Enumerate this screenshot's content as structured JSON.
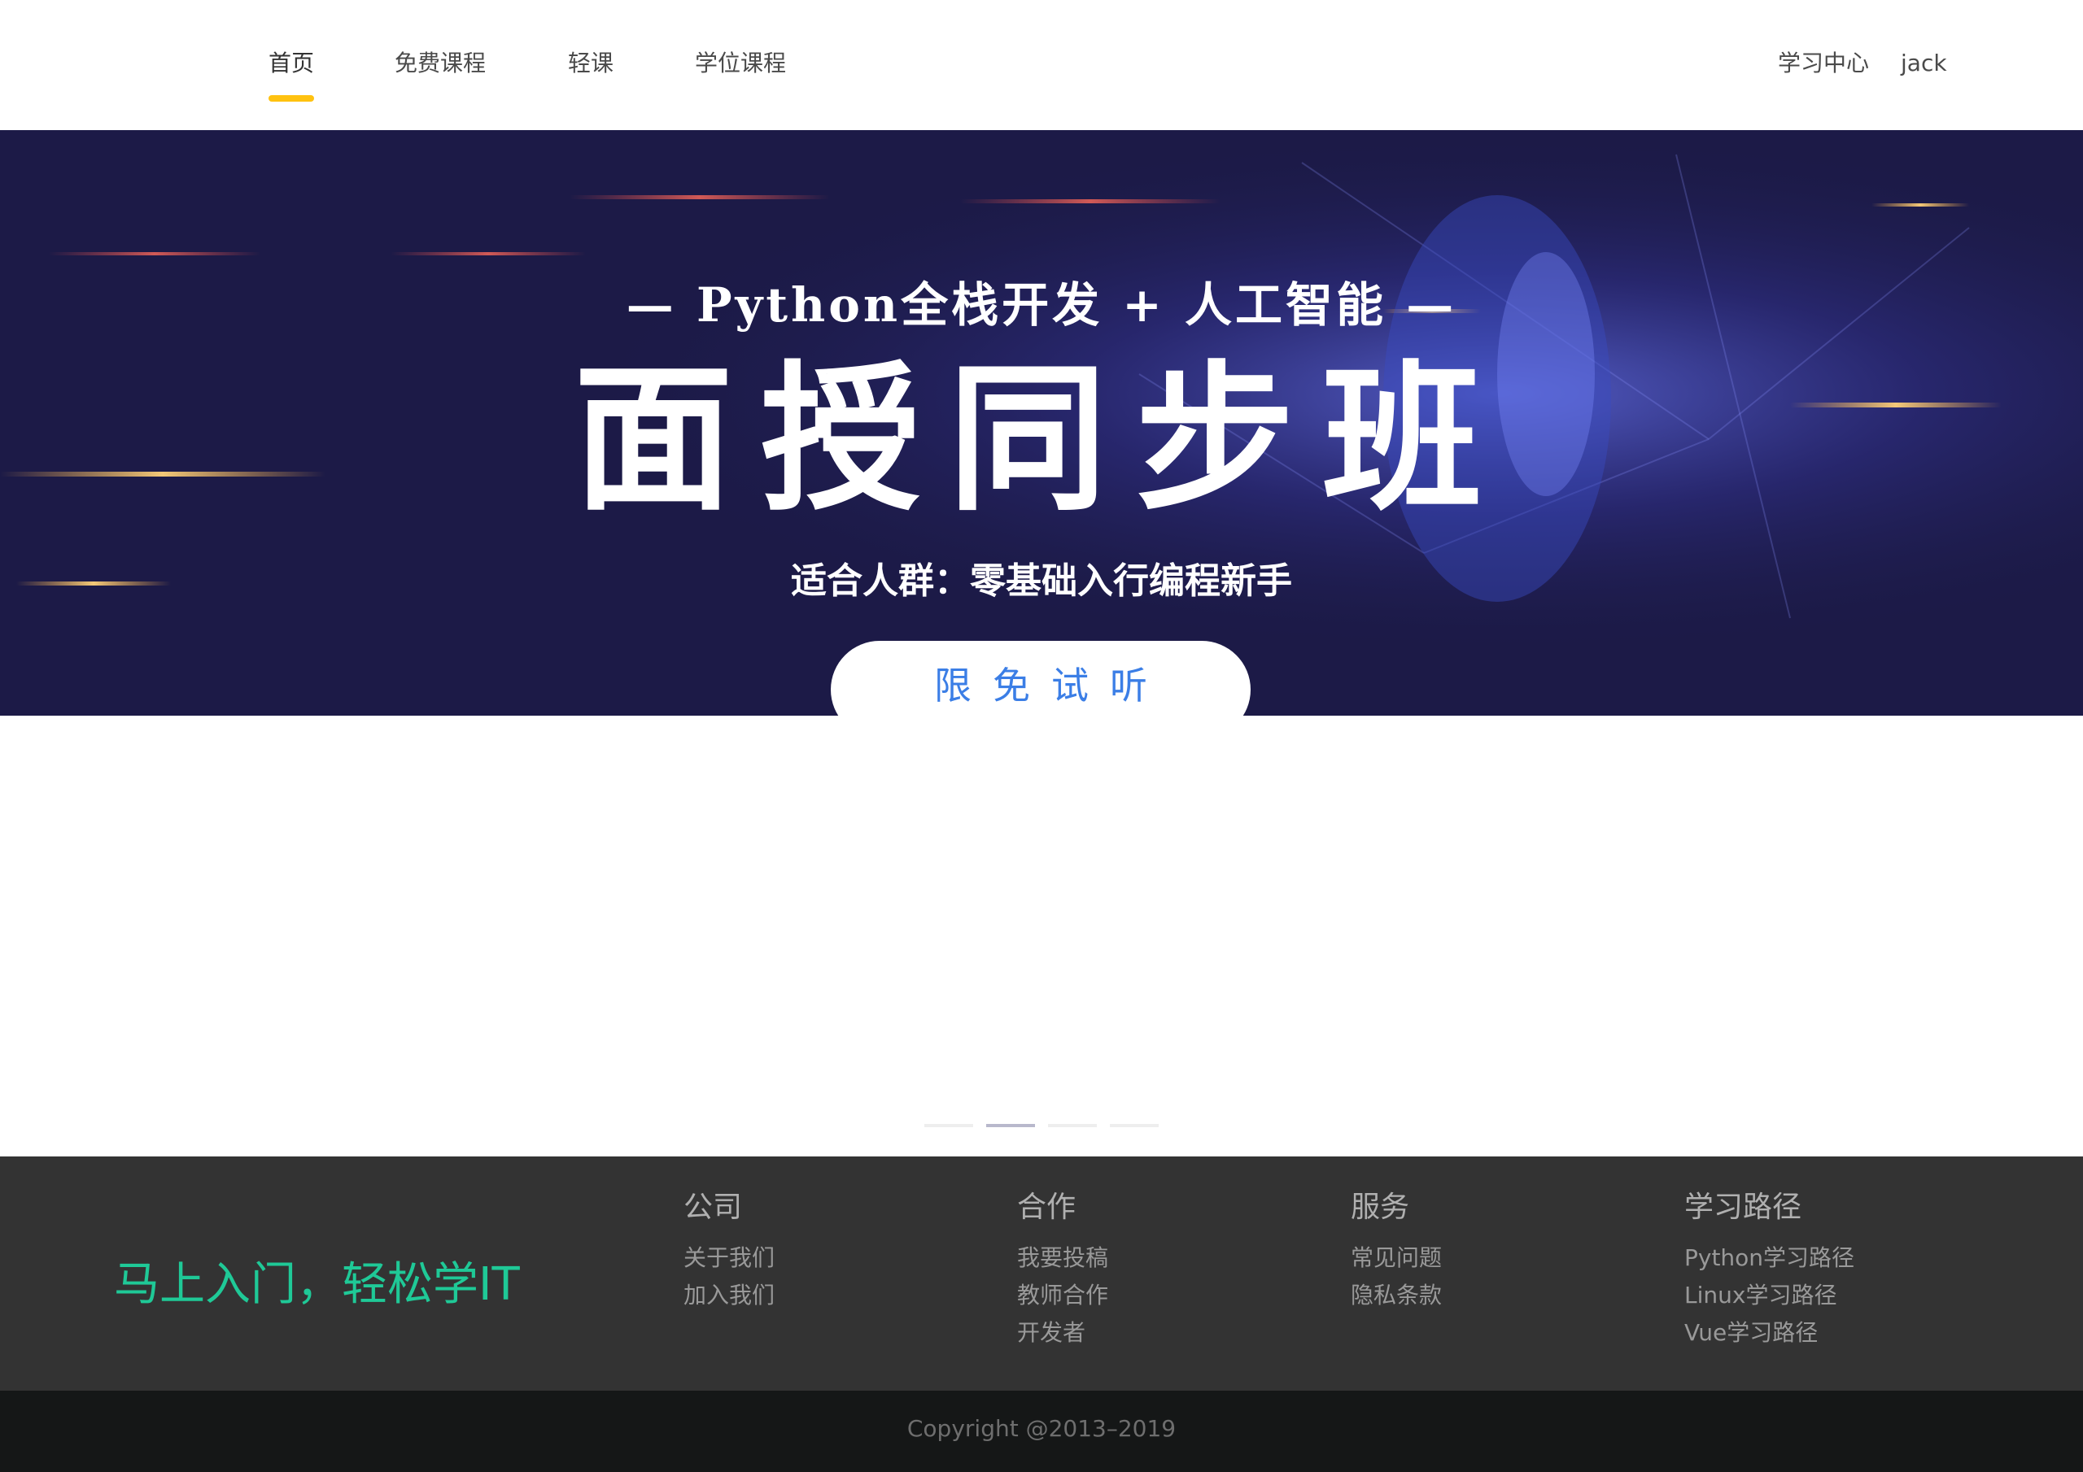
{
  "header": {
    "nav": [
      {
        "label": "首页",
        "active": true
      },
      {
        "label": "免费课程",
        "active": false
      },
      {
        "label": "轻课",
        "active": false
      },
      {
        "label": "学位课程",
        "active": false
      }
    ],
    "learning_center": "学习中心",
    "username": "jack",
    "accent_color": "#ffc210"
  },
  "banner": {
    "subtitle": "— Python全栈开发 + 人工智能 —",
    "title": "面授同步班",
    "audience": "适合人群：零基础入行编程新手",
    "cta": "限免试听"
  },
  "carousel": {
    "slide_count": 4,
    "active_index": 1
  },
  "footer": {
    "slogan": "马上入门，轻松学IT",
    "slogan_color": "#1fc997",
    "columns": [
      {
        "title": "公司",
        "links": [
          "关于我们",
          "加入我们"
        ]
      },
      {
        "title": "合作",
        "links": [
          "我要投稿",
          "教师合作",
          "开发者"
        ]
      },
      {
        "title": "服务",
        "links": [
          "常见问题",
          "隐私条款"
        ]
      },
      {
        "title": "学习路径",
        "links": [
          "Python学习路径",
          "Linux学习路径",
          "Vue学习路径"
        ]
      }
    ],
    "copyright": "Copyright @2013–2019"
  }
}
